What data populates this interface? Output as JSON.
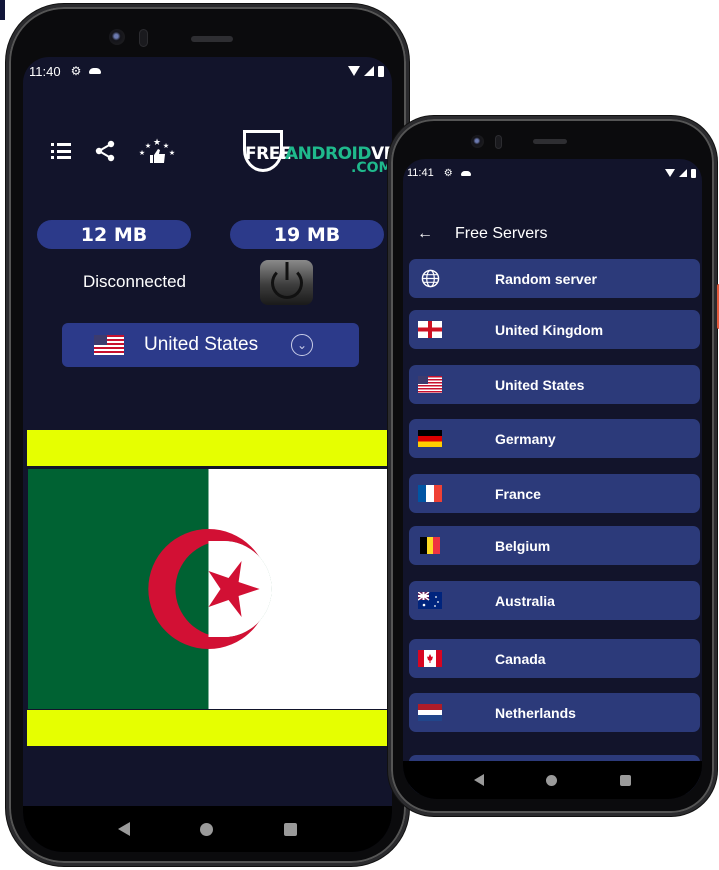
{
  "left_phone": {
    "status_bar": {
      "time": "11:40"
    },
    "toolbar": {
      "icons": [
        "list-icon",
        "share-icon",
        "rate-icon"
      ]
    },
    "logo": {
      "free": "FREE",
      "android": "ANDROID",
      "vpn": "VPN",
      "com": ".COM"
    },
    "stats": {
      "download": "12 MB",
      "upload": "19 MB"
    },
    "connection_status": "Disconnected",
    "selected_country": "United States",
    "ad_banner": {
      "flag": "Algeria",
      "bar_color": "#e6ff00"
    }
  },
  "right_phone": {
    "status_bar": {
      "time": "11:41"
    },
    "header": {
      "title": "Free Servers",
      "back_icon": "←"
    },
    "servers": [
      {
        "name": "Random server",
        "icon": "globe"
      },
      {
        "name": "United Kingdom",
        "icon": "flag-gb"
      },
      {
        "name": "United States",
        "icon": "flag-us"
      },
      {
        "name": "Germany",
        "icon": "flag-de"
      },
      {
        "name": "France",
        "icon": "flag-fr"
      },
      {
        "name": "Belgium",
        "icon": "flag-be"
      },
      {
        "name": "Australia",
        "icon": "flag-au"
      },
      {
        "name": "Canada",
        "icon": "flag-ca"
      },
      {
        "name": "Netherlands",
        "icon": "flag-nl"
      },
      {
        "name": "",
        "icon": ""
      }
    ]
  },
  "colors": {
    "background": "#12142b",
    "accent": "#2c3a8a",
    "list_item": "#2c3a7a",
    "logo_green": "#1fb98c"
  }
}
